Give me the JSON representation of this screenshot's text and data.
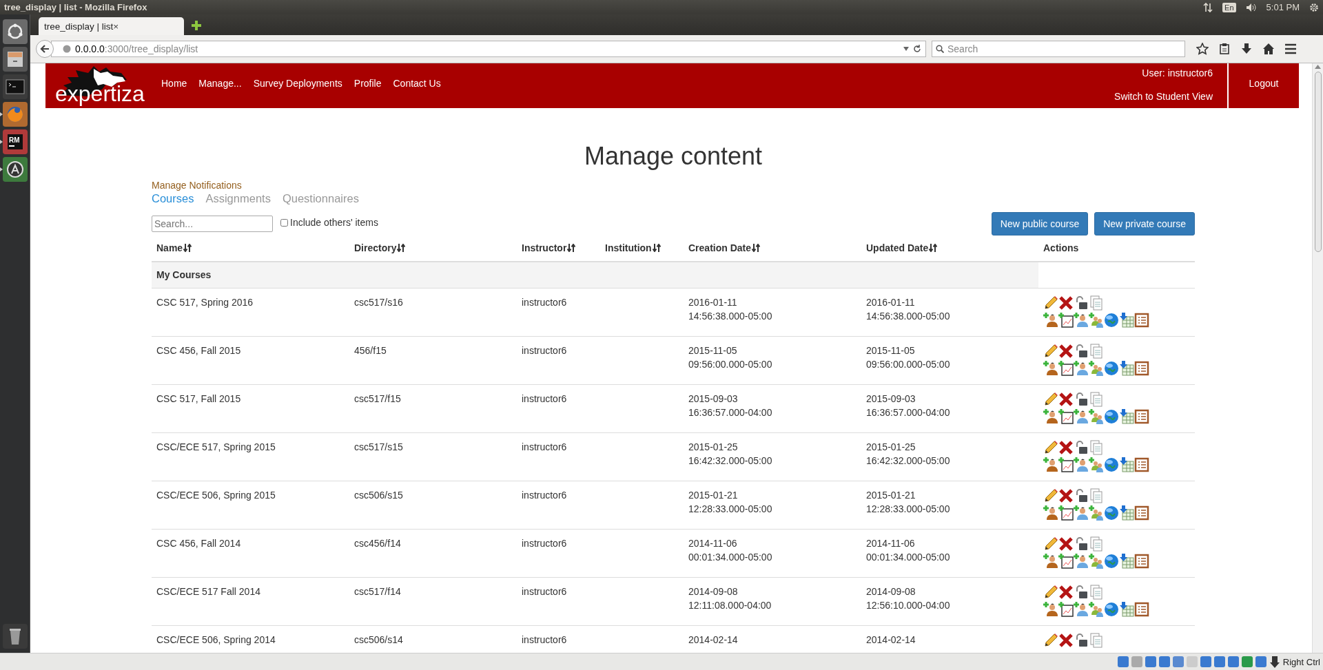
{
  "os_bar": {
    "title": "tree_display | list - Mozilla Firefox",
    "keyboard": "En",
    "time": "5:01 PM"
  },
  "launcher": {
    "items": [
      {
        "kind": "dash",
        "running": false
      },
      {
        "kind": "files",
        "running": false
      },
      {
        "kind": "terminal",
        "running": false
      },
      {
        "kind": "firefox",
        "running": true
      },
      {
        "kind": "rubymine",
        "label": "RM",
        "running": true
      },
      {
        "kind": "updater",
        "running": true
      },
      {
        "kind": "trash",
        "running": false
      }
    ]
  },
  "browser": {
    "tab": {
      "title": "tree_display | list",
      "close": "×"
    },
    "url": {
      "host": "0.0.0.0",
      "path": ":3000/tree_display/list"
    },
    "search": {
      "placeholder": "Search"
    }
  },
  "header": {
    "logo": "expertiza",
    "nav": [
      "Home",
      "Manage...",
      "Survey Deployments",
      "Profile",
      "Contact Us"
    ],
    "user": "User: instructor6",
    "switch_view": "Switch to Student View",
    "logout": "Logout"
  },
  "page": {
    "title": "Manage content",
    "notifications_link": "Manage Notifications",
    "tabs": [
      {
        "label": "Courses",
        "selected": true
      },
      {
        "label": "Assignments",
        "selected": false
      },
      {
        "label": "Questionnaires",
        "selected": false
      }
    ],
    "search": {
      "placeholder": "Search..."
    },
    "include_others": {
      "label": "Include others' items",
      "checked": false
    },
    "buttons": [
      "New public course",
      "New private course"
    ]
  },
  "table": {
    "columns": [
      {
        "label": "Name",
        "sortable": true
      },
      {
        "label": "Directory",
        "sortable": true
      },
      {
        "label": "Instructor",
        "sortable": true
      },
      {
        "label": "Institution",
        "sortable": true
      },
      {
        "label": "Creation Date",
        "sortable": true
      },
      {
        "label": "Updated Date",
        "sortable": true
      },
      {
        "label": "Actions",
        "sortable": false
      }
    ],
    "group": "My Courses",
    "rows": [
      {
        "name": "CSC 517, Spring 2016",
        "directory": "csc517/s16",
        "instructor": "instructor6",
        "created_date": "2016-01-11",
        "created_time": "14:56:38.000-05:00",
        "updated_date": "2016-01-11",
        "updated_time": "14:56:38.000-05:00",
        "partial": false
      },
      {
        "name": "CSC 456, Fall 2015",
        "directory": "456/f15",
        "instructor": "instructor6",
        "created_date": "2015-11-05",
        "created_time": "09:56:00.000-05:00",
        "updated_date": "2015-11-05",
        "updated_time": "09:56:00.000-05:00",
        "partial": false
      },
      {
        "name": "CSC 517, Fall 2015",
        "directory": "csc517/f15",
        "instructor": "instructor6",
        "created_date": "2015-09-03",
        "created_time": "16:36:57.000-04:00",
        "updated_date": "2015-09-03",
        "updated_time": "16:36:57.000-04:00",
        "partial": false
      },
      {
        "name": "CSC/ECE 517, Spring 2015",
        "directory": "csc517/s15",
        "instructor": "instructor6",
        "created_date": "2015-01-25",
        "created_time": "16:42:32.000-05:00",
        "updated_date": "2015-01-25",
        "updated_time": "16:42:32.000-05:00",
        "partial": false
      },
      {
        "name": "CSC/ECE 506, Spring 2015",
        "directory": "csc506/s15",
        "instructor": "instructor6",
        "created_date": "2015-01-21",
        "created_time": "12:28:33.000-05:00",
        "updated_date": "2015-01-21",
        "updated_time": "12:28:33.000-05:00",
        "partial": false
      },
      {
        "name": "CSC 456, Fall 2014",
        "directory": "csc456/f14",
        "instructor": "instructor6",
        "created_date": "2014-11-06",
        "created_time": "00:01:34.000-05:00",
        "updated_date": "2014-11-06",
        "updated_time": "00:01:34.000-05:00",
        "partial": false
      },
      {
        "name": "CSC/ECE 517 Fall 2014",
        "directory": "csc517/f14",
        "instructor": "instructor6",
        "created_date": "2014-09-08",
        "created_time": "12:11:08.000-04:00",
        "updated_date": "2014-09-08",
        "updated_time": "12:56:10.000-04:00",
        "partial": false
      },
      {
        "name": "CSC/ECE 506, Spring 2014",
        "directory": "csc506/s14",
        "instructor": "instructor6",
        "created_date": "2014-02-14",
        "updated_date": "2014-02-14",
        "partial": true
      }
    ]
  },
  "status_bar": {
    "host_key": "Right Ctrl"
  }
}
